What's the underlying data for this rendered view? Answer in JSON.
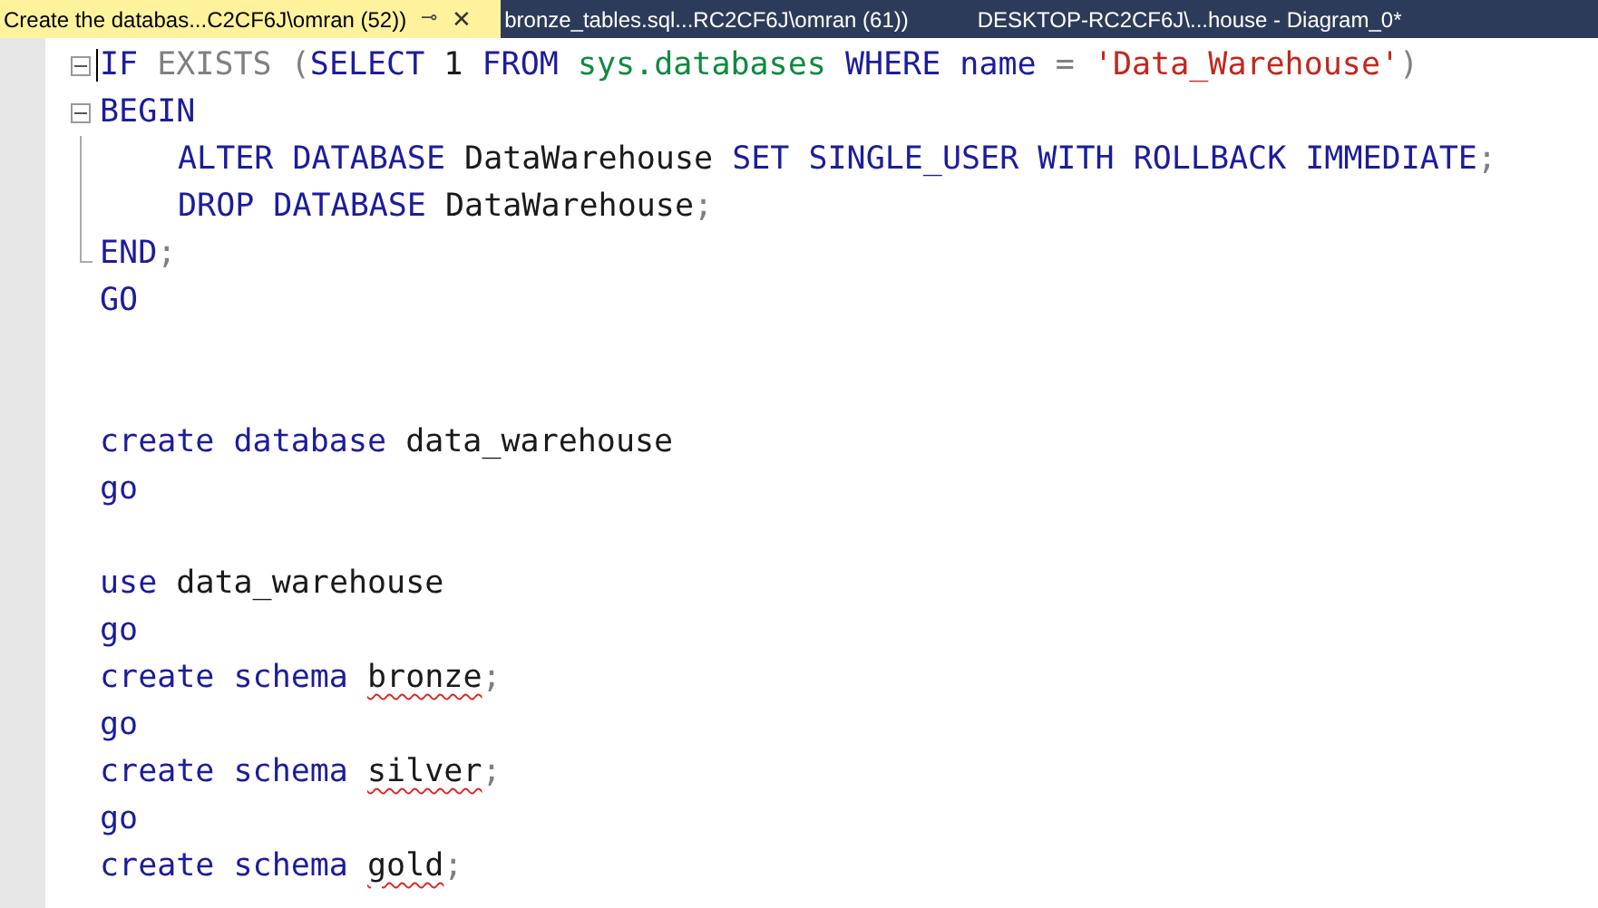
{
  "tabs": [
    {
      "label": "Create the databas...C2CF6J\\omran (52))",
      "selected": true,
      "pin": "⊸",
      "close": "✕"
    },
    {
      "label": "bronze_tables.sql...RC2CF6J\\omran (61))",
      "selected": false
    },
    {
      "label": "DESKTOP-RC2CF6J\\...house - Diagram_0*",
      "selected": false
    }
  ],
  "editor": {
    "lines": [
      {
        "kind": "code",
        "collapsible": true,
        "caret": true,
        "tokens": [
          {
            "t": "IF ",
            "kind": "kw"
          },
          {
            "t": "EXISTS (",
            "kind": "gray"
          },
          {
            "t": "SELECT ",
            "kind": "kw"
          },
          {
            "t": "1 ",
            "kind": "num"
          },
          {
            "t": "FROM ",
            "kind": "kw"
          },
          {
            "t": "sys.databases ",
            "kind": "sys"
          },
          {
            "t": "WHERE ",
            "kind": "kw"
          },
          {
            "t": "name ",
            "kind": "kw"
          },
          {
            "t": "= ",
            "kind": "gray"
          },
          {
            "t": "'Data_Warehouse'",
            "kind": "str"
          },
          {
            "t": ")",
            "kind": "gray"
          }
        ]
      },
      {
        "kind": "code",
        "collapsible": true,
        "tokens": [
          {
            "t": "BEGIN",
            "kind": "kw"
          }
        ]
      },
      {
        "kind": "code",
        "in_block": true,
        "indented": true,
        "tokens": [
          {
            "t": "ALTER DATABASE ",
            "kind": "kw"
          },
          {
            "t": "DataWarehouse ",
            "kind": "id"
          },
          {
            "t": "SET SINGLE_USER WITH ROLLBACK IMMEDIATE",
            "kind": "kw"
          },
          {
            "t": ";",
            "kind": "gray"
          }
        ]
      },
      {
        "kind": "code",
        "in_block": true,
        "indented": true,
        "tokens": [
          {
            "t": "DROP DATABASE ",
            "kind": "kw"
          },
          {
            "t": "DataWarehouse",
            "kind": "id"
          },
          {
            "t": ";",
            "kind": "gray"
          }
        ]
      },
      {
        "kind": "code",
        "block_end": true,
        "tokens": [
          {
            "t": "END",
            "kind": "kw"
          },
          {
            "t": ";",
            "kind": "gray"
          }
        ]
      },
      {
        "kind": "code",
        "tokens": [
          {
            "t": "GO",
            "kind": "kw"
          }
        ]
      },
      {
        "kind": "blank"
      },
      {
        "kind": "blank"
      },
      {
        "kind": "code",
        "tokens": [
          {
            "t": "create database ",
            "kind": "kw"
          },
          {
            "t": "data_warehouse",
            "kind": "id"
          }
        ]
      },
      {
        "kind": "code",
        "tokens": [
          {
            "t": "go",
            "kind": "kw"
          }
        ]
      },
      {
        "kind": "blank"
      },
      {
        "kind": "code",
        "tokens": [
          {
            "t": "use ",
            "kind": "kw"
          },
          {
            "t": "data_warehouse",
            "kind": "id"
          }
        ]
      },
      {
        "kind": "code",
        "tokens": [
          {
            "t": "go",
            "kind": "kw"
          }
        ]
      },
      {
        "kind": "code",
        "tokens": [
          {
            "t": "create schema ",
            "kind": "kw"
          },
          {
            "t": "bronze",
            "kind": "id",
            "squiggle": true
          },
          {
            "t": ";",
            "kind": "gray"
          }
        ]
      },
      {
        "kind": "code",
        "tokens": [
          {
            "t": "go",
            "kind": "kw"
          }
        ]
      },
      {
        "kind": "code",
        "tokens": [
          {
            "t": "create schema ",
            "kind": "kw"
          },
          {
            "t": "silver",
            "kind": "id",
            "squiggle": true
          },
          {
            "t": ";",
            "kind": "gray"
          }
        ]
      },
      {
        "kind": "code",
        "tokens": [
          {
            "t": "go",
            "kind": "kw"
          }
        ]
      },
      {
        "kind": "code",
        "tokens": [
          {
            "t": "create schema ",
            "kind": "kw"
          },
          {
            "t": "gold",
            "kind": "id",
            "squiggle": true
          },
          {
            "t": ";",
            "kind": "gray"
          }
        ]
      }
    ]
  }
}
